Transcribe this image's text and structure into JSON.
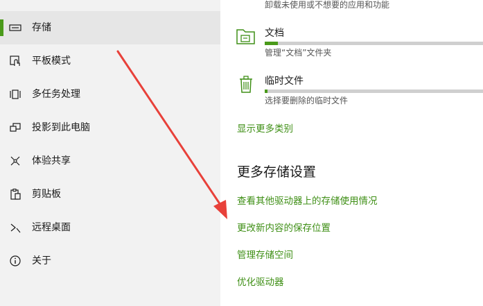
{
  "nav": {
    "items": [
      {
        "label": "存储",
        "icon": "storage-icon",
        "selected": true
      },
      {
        "label": "平板模式",
        "icon": "tablet-mode-icon"
      },
      {
        "label": "多任务处理",
        "icon": "multitasking-icon"
      },
      {
        "label": "投影到此电脑",
        "icon": "project-to-pc-icon"
      },
      {
        "label": "体验共享",
        "icon": "shared-experiences-icon"
      },
      {
        "label": "剪贴板",
        "icon": "clipboard-icon"
      },
      {
        "label": "远程桌面",
        "icon": "remote-desktop-icon"
      },
      {
        "label": "关于",
        "icon": "info-icon"
      }
    ]
  },
  "main": {
    "faded_text": "卸载未使用或不想要的应用和功能",
    "categories": [
      {
        "name": "文档",
        "desc": "管理“文档”文件夹",
        "icon": "documents-folder-icon",
        "usage": 0.06
      },
      {
        "name": "临时文件",
        "desc": "选择要删除的临时文件",
        "icon": "trash-icon",
        "usage": 0.01
      }
    ],
    "show_more": "显示更多类别",
    "more_settings_title": "更多存储设置",
    "links": [
      "查看其他驱动器上的存储使用情况",
      "更改新内容的保存位置",
      "管理存储空间",
      "优化驱动器"
    ]
  },
  "colors": {
    "accent": "#4a9a1a",
    "link": "#3f8f16",
    "annotation_arrow": "#e8413a"
  }
}
